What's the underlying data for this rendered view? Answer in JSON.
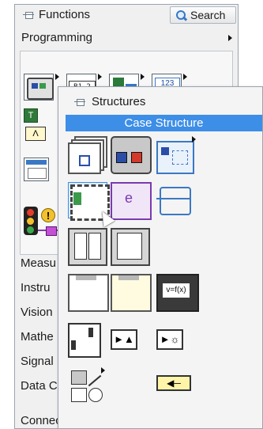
{
  "palette": {
    "header_title": "Functions",
    "search_label": "Search",
    "subcategory": "Programming",
    "categories": [
      "Measu",
      "Instru",
      "Vision",
      "Mathe",
      "Signal",
      "Data C",
      "Connectivity"
    ]
  },
  "structures_menu": {
    "title": "Structures",
    "highlighted_item": "Case Structure",
    "icon_names": [
      "stacked-sequence-icon",
      "flat-sequence-icon",
      "event-structure-submenu-icon",
      "case-structure-icon",
      "formula-node-e-icon",
      "diagram-disable-icon",
      "flat-frame-icon",
      "timed-loop-icon",
      "while-loop-box-icon",
      "for-loop-box-icon",
      "mathscript-node-icon",
      "subvi-node-icon",
      "feedback-up-icon",
      "global-variable-icon",
      "decorations-submenu-icon",
      "feedback-node-icon"
    ],
    "formula_text": "v=f(x)"
  },
  "colors": {
    "highlight": "#3d8ee6",
    "panel_bg": "#f0f0f0"
  }
}
